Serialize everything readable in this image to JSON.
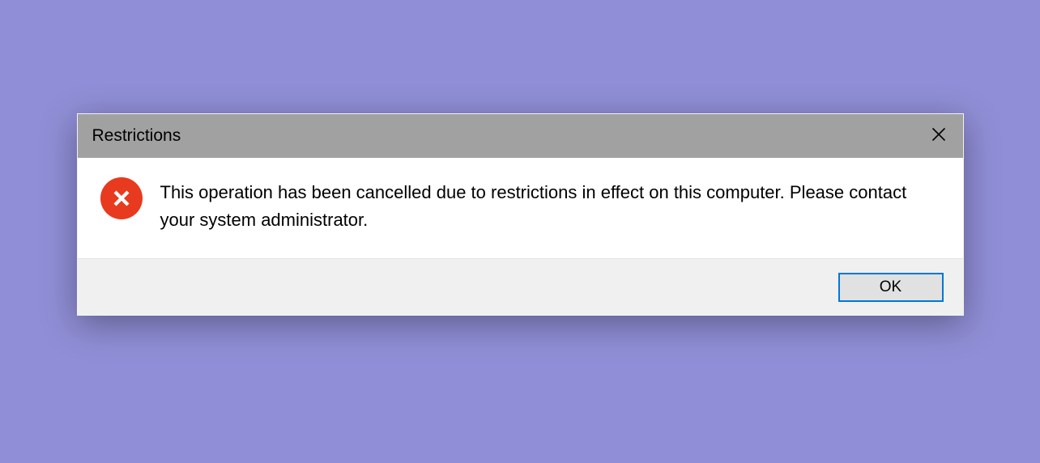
{
  "dialog": {
    "title": "Restrictions",
    "icon_name": "error-icon",
    "message": "This operation has been cancelled due to restrictions in effect on this computer. Please contact your system administrator.",
    "buttons": {
      "ok_label": "OK"
    },
    "colors": {
      "error_red": "#e83a1e",
      "accent_blue": "#0078d7",
      "titlebar_gray": "#a1a1a1",
      "footer_gray": "#f0f0f0"
    }
  }
}
